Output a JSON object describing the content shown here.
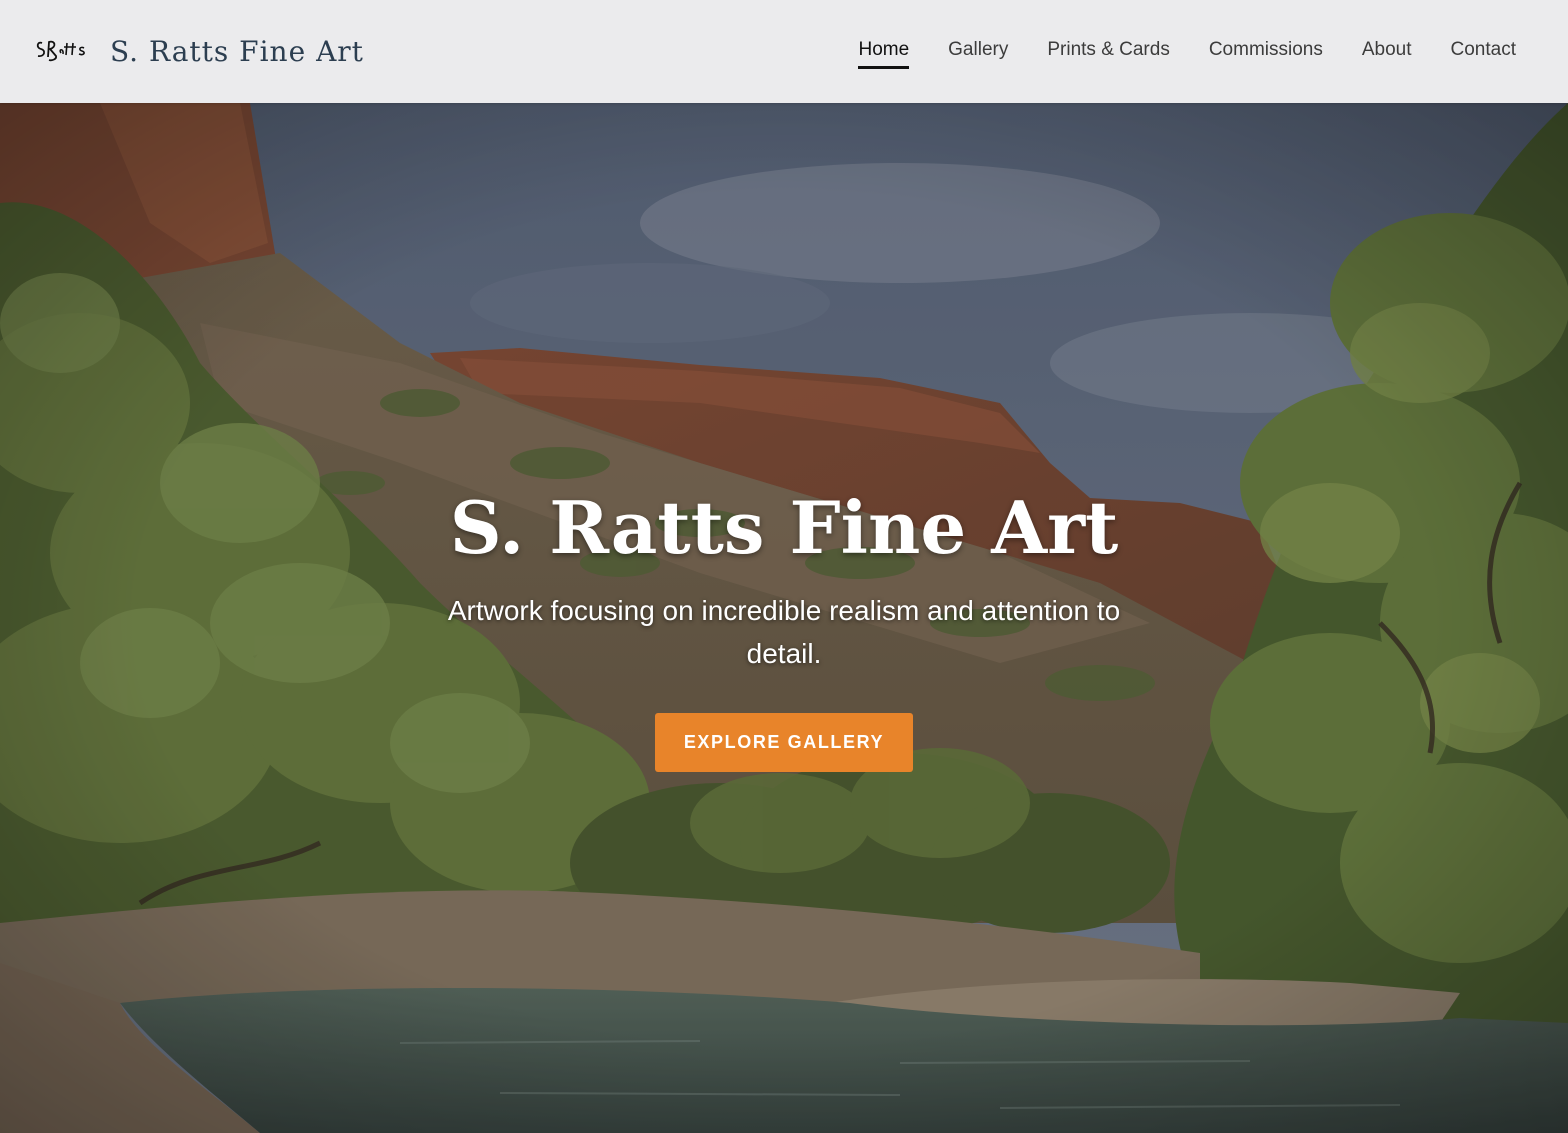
{
  "header": {
    "logo_text": "SRatts",
    "site_title": "S. Ratts Fine Art",
    "nav": [
      {
        "label": "Home",
        "active": true
      },
      {
        "label": "Gallery",
        "active": false
      },
      {
        "label": "Prints & Cards",
        "active": false
      },
      {
        "label": "Commissions",
        "active": false
      },
      {
        "label": "About",
        "active": false
      },
      {
        "label": "Contact",
        "active": false
      }
    ]
  },
  "hero": {
    "title": "S. Ratts Fine Art",
    "subtitle": "Artwork focusing on incredible realism and attention to detail.",
    "cta_label": "EXPLORE GALLERY",
    "background": "canyon-river-painting"
  },
  "colors": {
    "accent": "#e8842a",
    "title": "#2c3e50",
    "header_bg": "#ebebed"
  }
}
